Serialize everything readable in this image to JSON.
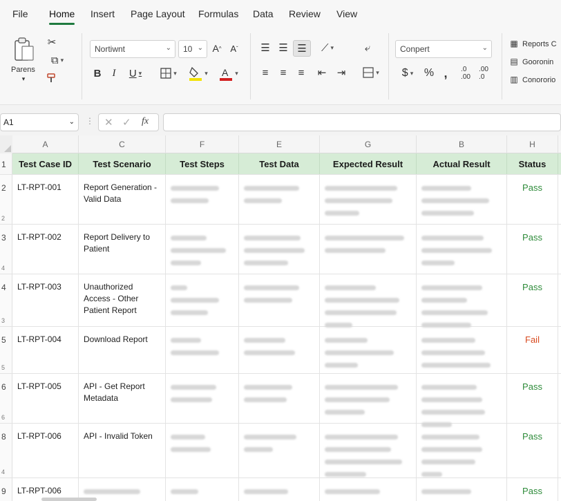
{
  "menu": {
    "tabs": [
      "File",
      "Home",
      "Insert",
      "Page Layout",
      "Formulas",
      "Data",
      "Review",
      "View"
    ],
    "active": "Home"
  },
  "ribbon": {
    "paste_label": "Parens",
    "font_name": "Nortiwnt",
    "font_size": "10",
    "number_format": "Conpert",
    "right_items": [
      "Reports C",
      "Gooronin",
      "Conororio"
    ]
  },
  "formula_bar": {
    "name_box": "A1",
    "fx_label": "fx",
    "formula": ""
  },
  "grid": {
    "column_letters": [
      "A",
      "C",
      "F",
      "E",
      "G",
      "B",
      "H"
    ],
    "headers": [
      "Test Case ID",
      "Test Scenario",
      "Test Steps",
      "Test Data",
      "Expected Result",
      "Actual Result",
      "Status"
    ],
    "header_row_number": "1",
    "rows": [
      {
        "num": "2",
        "sub": "2",
        "id": "LT-RPT-001",
        "scenario": "Report Generation - Valid Data",
        "status": "Pass"
      },
      {
        "num": "3",
        "sub": "4",
        "id": "LT-RPT-002",
        "scenario": "Report Delivery to Patient",
        "status": "Pass"
      },
      {
        "num": "4",
        "sub": "3",
        "id": "LT-RPT-003",
        "scenario": "Unauthorized Access - Other Patient Report",
        "status": "Pass"
      },
      {
        "num": "5",
        "sub": "5",
        "id": "LT-RPT-004",
        "scenario": "Download Report",
        "status": "Fail"
      },
      {
        "num": "6",
        "sub": "6",
        "id": "LT-RPT-005",
        "scenario": "API - Get Report Metadata",
        "status": "Pass"
      },
      {
        "num": "8",
        "sub": "4",
        "id": "LT-RPT-006",
        "scenario": "API - Invalid Token",
        "status": "Pass"
      },
      {
        "num": "9",
        "sub": "",
        "id": "LT-RPT-006",
        "scenario": "",
        "status": "Pass"
      }
    ]
  },
  "colors": {
    "header_fill": "#d6ecd6",
    "pass": "#2e8b3a",
    "fail": "#d84a1f",
    "accent": "#1f7a3f"
  }
}
